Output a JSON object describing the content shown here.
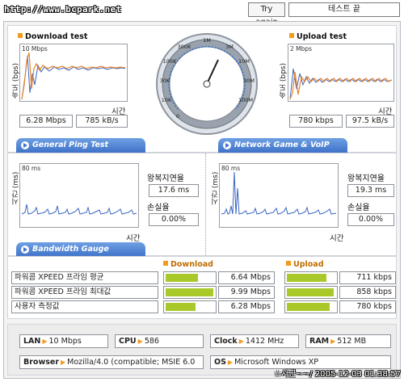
{
  "topbar": {
    "url": "http://www.bcpark.net",
    "retry_label": "Try again",
    "end_label": "테스트 끝"
  },
  "download": {
    "title": "Download test",
    "ylabel": "속도 (bps)",
    "scale": "10 Mbps",
    "xlabel": "시간",
    "mbps": "6.28 Mbps",
    "kbs": "785 kB/s"
  },
  "upload": {
    "title": "Upload test",
    "ylabel": "속도 (bps)",
    "scale": "2 Mbps",
    "xlabel": "시간",
    "kbps": "780 kbps",
    "kbs": "97.5 kB/s"
  },
  "gauge": {
    "ticks": [
      "0",
      "10K",
      "30K",
      "100K",
      "300K",
      "1M",
      "3M",
      "10M",
      "30M",
      "100M"
    ]
  },
  "tabs": {
    "ping": "General Ping Test",
    "game": "Network Game & VoIP Test",
    "bandwidth": "Bandwidth Gauge"
  },
  "ping": {
    "ylabel": "시간 (ms)",
    "scale": "80 ms",
    "xlabel": "시간",
    "latency_label": "왕복지연율",
    "latency": "17.6 ms",
    "loss_label": "손실율",
    "loss": "0.00%"
  },
  "game": {
    "ylabel": "시간 (ms)",
    "scale": "80 ms",
    "xlabel": "시간",
    "latency_label": "왕복지연율",
    "latency": "19.3 ms",
    "loss_label": "손실율",
    "loss": "0.00%"
  },
  "bandwidth": {
    "download_header": "Download",
    "upload_header": "Upload",
    "rows": [
      {
        "name": "파워콤 XPEED 프라임 평균",
        "down_value": "6.64 Mbps",
        "down_fill": 0.66,
        "up_value": "711 kbps",
        "up_fill": 0.81
      },
      {
        "name": "파워콤 XPEED 프라임 최대값",
        "down_value": "9.99 Mbps",
        "down_fill": 0.99,
        "up_value": "858 kbps",
        "up_fill": 0.97
      },
      {
        "name": "사용자 측정값",
        "down_value": "6.28 Mbps",
        "down_fill": 0.62,
        "up_value": "780 kbps",
        "up_fill": 0.88
      }
    ]
  },
  "sysinfo": {
    "lan_label": "LAN",
    "lan": "10 Mbps",
    "cpu_label": "CPU",
    "cpu": "586",
    "clock_label": "Clock",
    "clock": "1412 MHz",
    "ram_label": "RAM",
    "ram": "512 MB",
    "browser_label": "Browser",
    "browser": "Mozilla/4.0 (compatible; MSIE 6.0",
    "os_label": "OS",
    "os": "Microsoft Windows XP"
  },
  "stamp": "☆사군~~/ 2005-12-03 01:38:57",
  "colors": {
    "accent": "#f29a1a",
    "bar": "#a9c92b",
    "tab": "#3f72c8",
    "line_down": "#e8842a",
    "line_blue": "#3a66c4"
  }
}
